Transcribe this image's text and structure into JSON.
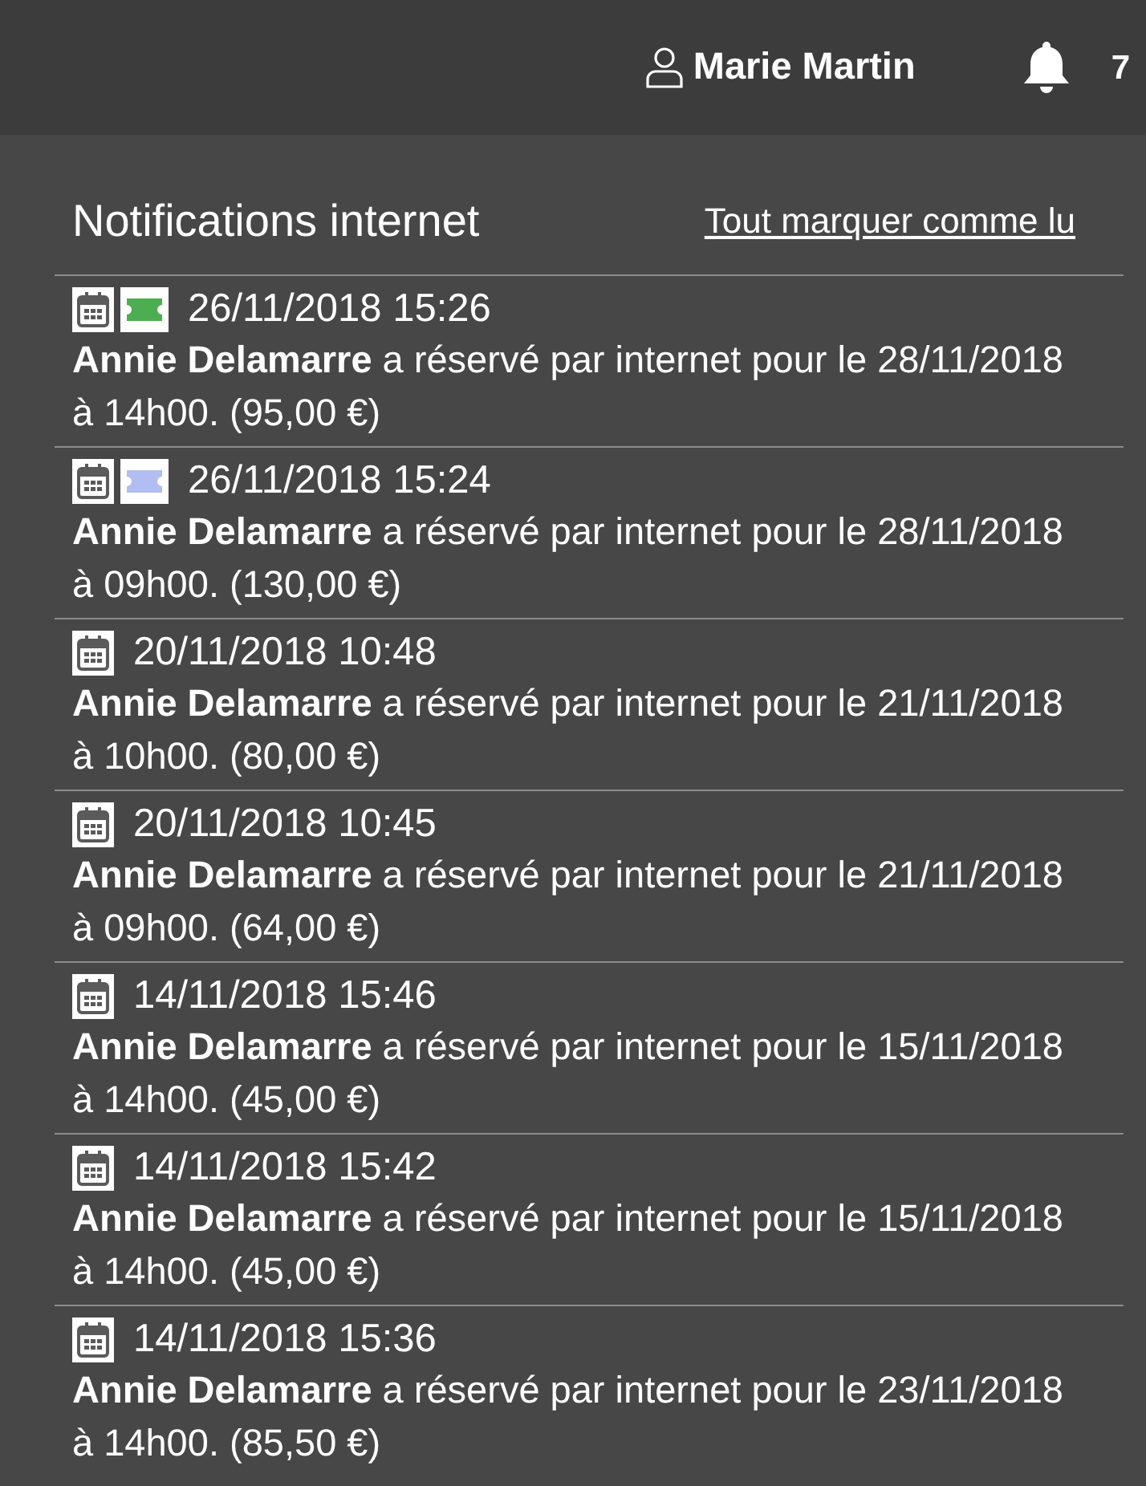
{
  "header": {
    "user": "Marie Martin",
    "notification_count": "7"
  },
  "panel": {
    "title": "Notifications internet",
    "mark_all_read": "Tout marquer comme lu"
  },
  "notifications": [
    {
      "icons": [
        {
          "kind": "calendar"
        },
        {
          "kind": "ticket",
          "color": "#4cae50"
        }
      ],
      "datetime": "26/11/2018 15:26",
      "message": "**Annie Delamarre** a réservé par internet pour le 28/11/2018 à 14h00. (95,00 €)"
    },
    {
      "icons": [
        {
          "kind": "calendar"
        },
        {
          "kind": "ticket",
          "color": "#b0bef2"
        }
      ],
      "datetime": "26/11/2018 15:24",
      "message": "**Annie Delamarre** a réservé par internet pour le 28/11/2018 à 09h00. (130,00 €)"
    },
    {
      "icons": [
        {
          "kind": "calendar"
        }
      ],
      "datetime": "20/11/2018 10:48",
      "message": "**Annie Delamarre** a réservé par internet pour le 21/11/2018 à 10h00. (80,00 €)"
    },
    {
      "icons": [
        {
          "kind": "calendar"
        }
      ],
      "datetime": "20/11/2018 10:45",
      "message": "**Annie Delamarre** a réservé par internet pour le 21/11/2018 à 09h00. (64,00 €)"
    },
    {
      "icons": [
        {
          "kind": "calendar"
        }
      ],
      "datetime": "14/11/2018 15:46",
      "message": "**Annie Delamarre** a réservé par internet pour le 15/11/2018 à 14h00. (45,00 €)"
    },
    {
      "icons": [
        {
          "kind": "calendar"
        }
      ],
      "datetime": "14/11/2018 15:42",
      "message": "**Annie Delamarre** a réservé par internet pour le 15/11/2018 à 14h00. (45,00 €)"
    },
    {
      "icons": [
        {
          "kind": "calendar"
        }
      ],
      "datetime": "14/11/2018 15:36",
      "message": "**Annie Delamarre** a réservé par internet pour le 23/11/2018 à 14h00. (85,50 €)"
    }
  ]
}
